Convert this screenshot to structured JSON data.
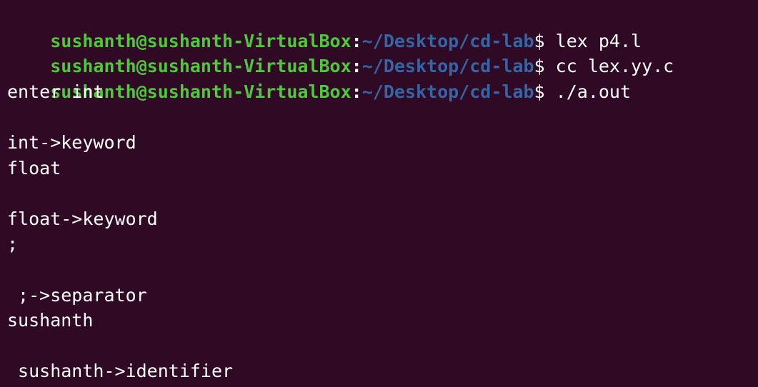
{
  "terminal": {
    "colors": {
      "background": "#300a24",
      "user_host": "#4ec93a",
      "path": "#3465a4",
      "text": "#ffffff"
    },
    "prompts": [
      {
        "user_host": "sushanth@sushanth-VirtualBox",
        "sep": ":",
        "path": "~/Desktop/cd-lab",
        "sign": "$",
        "command": " lex p4.l"
      },
      {
        "user_host": "sushanth@sushanth-VirtualBox",
        "sep": ":",
        "path": "~/Desktop/cd-lab",
        "sign": "$",
        "command": " cc lex.yy.c"
      },
      {
        "user_host": "sushanth@sushanth-VirtualBox",
        "sep": ":",
        "path": "~/Desktop/cd-lab",
        "sign": "$",
        "command": " ./a.out"
      }
    ],
    "output": [
      "enter int",
      "",
      "int->keyword",
      "float",
      "",
      "float->keyword",
      ";",
      "",
      " ;->separator",
      "sushanth",
      "",
      " sushanth->identifier"
    ]
  }
}
